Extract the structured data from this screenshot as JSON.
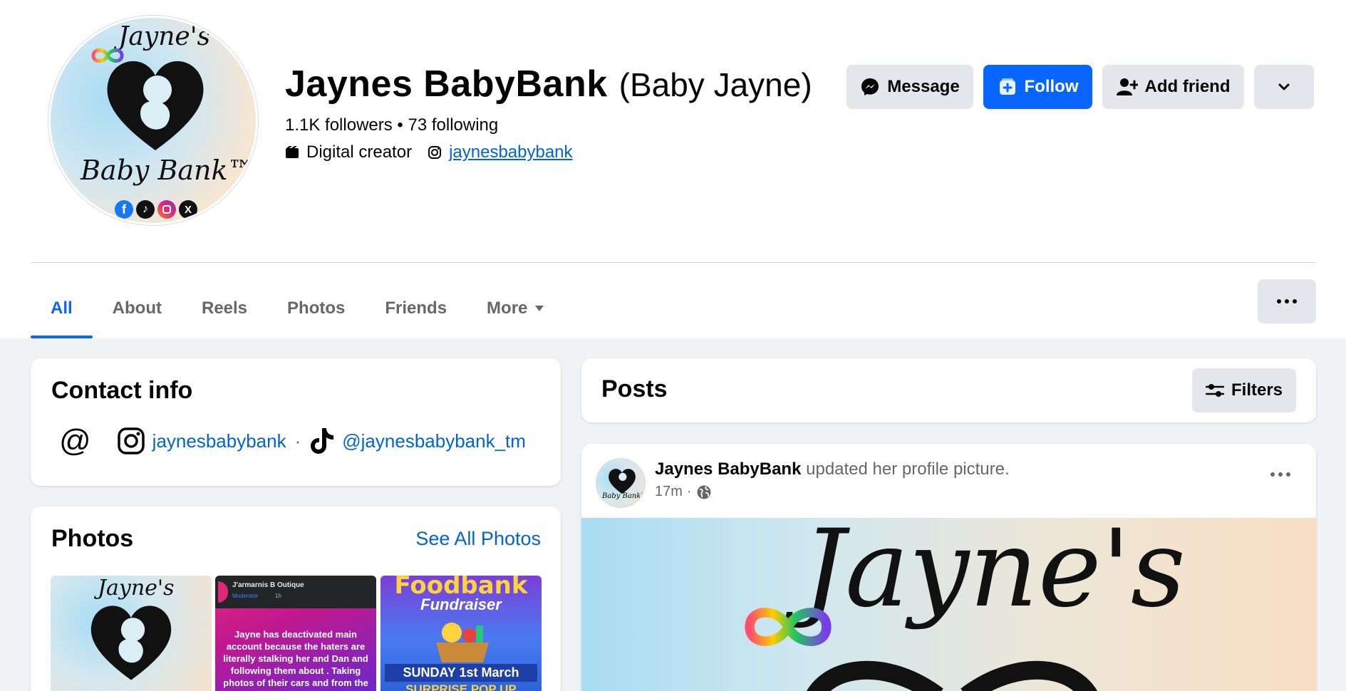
{
  "profile": {
    "name": "Jaynes BabyBank",
    "alternate_name": "(Baby Jayne)",
    "stats": "1.1K followers • 73 following",
    "category": "Digital creator",
    "instagram_handle": "jaynesbabybank",
    "avatar_logo_top": "Jayne's",
    "avatar_logo_bottom": "Baby Bank™",
    "avatar_social_icons": [
      "facebook-icon",
      "tiktok-icon",
      "instagram-icon",
      "x-icon"
    ]
  },
  "actions": {
    "message": "Message",
    "follow": "Follow",
    "add_friend": "Add friend"
  },
  "tabs": [
    {
      "label": "All",
      "active": true
    },
    {
      "label": "About",
      "active": false
    },
    {
      "label": "Reels",
      "active": false
    },
    {
      "label": "Photos",
      "active": false
    },
    {
      "label": "Friends",
      "active": false
    },
    {
      "label": "More",
      "active": false
    }
  ],
  "contact": {
    "title": "Contact info",
    "instagram": "jaynesbabybank",
    "separator": "·",
    "tiktok": "@jaynesbabybank_tm"
  },
  "photos": {
    "title": "Photos",
    "see_all": "See All Photos",
    "thumb2": {
      "group": "J'armarnis B Outique",
      "role": "Moderator",
      "time": "1h",
      "text": "Jayne has deactivated main account because the haters are literally stalking her and Dan and following them about . Taking photos of their cars and from the"
    },
    "thumb3": {
      "line1": "Foodbank",
      "line2": "Fundraiser",
      "line3": "SUNDAY 1st March",
      "line4": "SURPRISE POP UP"
    }
  },
  "posts": {
    "title": "Posts",
    "filters": "Filters",
    "post1": {
      "author": "Jaynes BabyBank",
      "action": "updated her profile picture.",
      "time": "17m",
      "separator": "·",
      "image_text": "Jayne's"
    }
  },
  "colors": {
    "accent": "#0866ff",
    "link": "#0064d1",
    "background": "#f0f2f5",
    "button_gray": "#e4e6eb"
  }
}
